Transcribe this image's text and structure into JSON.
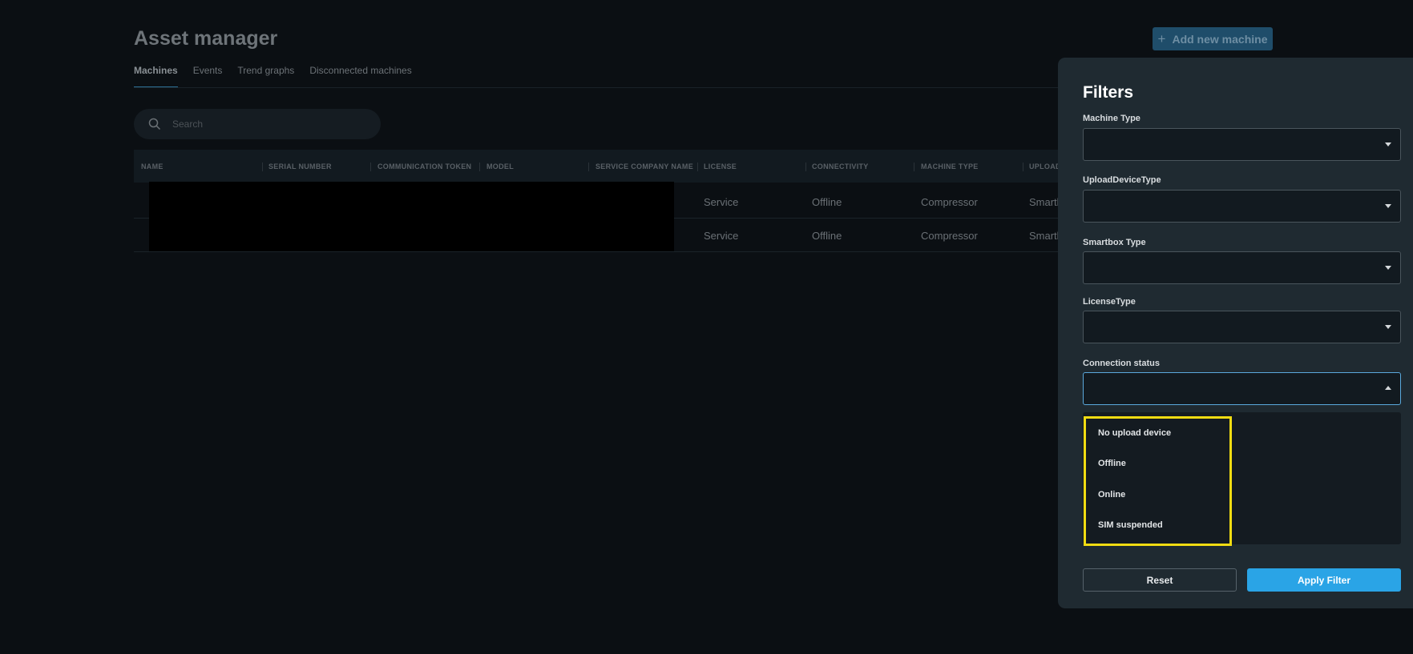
{
  "header": {
    "title": "Asset manager",
    "add_button_label": "Add new machine"
  },
  "tabs": [
    {
      "label": "Machines",
      "active": true
    },
    {
      "label": "Events",
      "active": false
    },
    {
      "label": "Trend graphs",
      "active": false
    },
    {
      "label": "Disconnected machines",
      "active": false
    }
  ],
  "search": {
    "placeholder": "Search",
    "value": ""
  },
  "table": {
    "columns": [
      "NAME",
      "SERIAL NUMBER",
      "COMMUNICATION TOKEN",
      "MODEL",
      "SERVICE COMPANY NAME",
      "LICENSE",
      "CONNECTIVITY",
      "MACHINE TYPE",
      "UPLOAD"
    ],
    "rows": [
      {
        "license": "Service",
        "connectivity": "Offline",
        "machine_type": "Compressor",
        "upload": "Smartb"
      },
      {
        "license": "Service",
        "connectivity": "Offline",
        "machine_type": "Compressor",
        "upload": "Smartb"
      }
    ]
  },
  "filters": {
    "title": "Filters",
    "fields": [
      {
        "label": "Machine Type",
        "value": ""
      },
      {
        "label": "UploadDeviceType",
        "value": ""
      },
      {
        "label": "Smartbox Type",
        "value": ""
      },
      {
        "label": "LicenseType",
        "value": ""
      },
      {
        "label": "Connection status",
        "value": "",
        "open": true
      }
    ],
    "connection_options": [
      "No upload device",
      "Offline",
      "Online",
      "SIM suspended"
    ],
    "reset_label": "Reset",
    "apply_label": "Apply Filter"
  },
  "colors": {
    "accent": "#2aa4e6",
    "highlight": "#f1dc12",
    "panel_bg": "#1f2a31",
    "page_bg": "#0b0f13"
  }
}
